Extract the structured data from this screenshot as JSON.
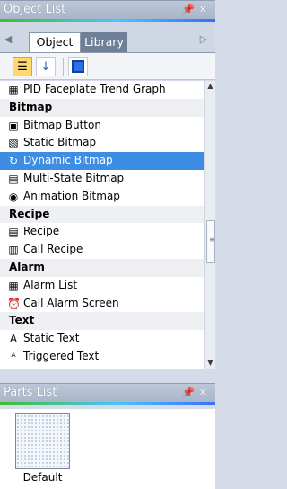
{
  "object_panel": {
    "title": "Object List",
    "title_icons": "† ×",
    "tabs": [
      {
        "label": "Object",
        "active": true
      },
      {
        "label": "Library",
        "active": false
      }
    ],
    "toolbar": {
      "categorized_icon": "categorized-view-icon",
      "sort_icon": "sort-az-icon",
      "view_icon": "large-icon-view-icon"
    },
    "rows": [
      {
        "type": "item",
        "label": "PID Faceplate Trend Graph",
        "icon": "pid-faceplate-icon",
        "glyph": "▦"
      },
      {
        "type": "cat",
        "label": "Bitmap"
      },
      {
        "type": "item",
        "label": "Bitmap Button",
        "icon": "bitmap-button-icon",
        "glyph": "▣"
      },
      {
        "type": "item",
        "label": "Static Bitmap",
        "icon": "static-bitmap-icon",
        "glyph": "▧"
      },
      {
        "type": "item",
        "label": "Dynamic Bitmap",
        "icon": "dynamic-bitmap-icon",
        "glyph": "↻",
        "selected": true
      },
      {
        "type": "item",
        "label": "Multi-State Bitmap",
        "icon": "multi-state-bitmap-icon",
        "glyph": "▤"
      },
      {
        "type": "item",
        "label": "Animation Bitmap",
        "icon": "animation-bitmap-icon",
        "glyph": "◉"
      },
      {
        "type": "cat",
        "label": "Recipe"
      },
      {
        "type": "item",
        "label": "Recipe",
        "icon": "recipe-icon",
        "glyph": "▤"
      },
      {
        "type": "item",
        "label": "Call Recipe",
        "icon": "call-recipe-icon",
        "glyph": "▥"
      },
      {
        "type": "cat",
        "label": "Alarm"
      },
      {
        "type": "item",
        "label": "Alarm List",
        "icon": "alarm-list-icon",
        "glyph": "▦"
      },
      {
        "type": "item",
        "label": "Call Alarm Screen",
        "icon": "alarm-clock-icon",
        "glyph": "⏰"
      },
      {
        "type": "cat",
        "label": "Text"
      },
      {
        "type": "item",
        "label": "Static Text",
        "icon": "static-text-icon",
        "glyph": "A"
      },
      {
        "type": "item",
        "label": "Triggered Text",
        "icon": "triggered-text-icon",
        "glyph": "ᴬ"
      }
    ]
  },
  "parts_panel": {
    "title": "Parts List",
    "title_icons": "† ×",
    "items": [
      {
        "label": "Default"
      }
    ]
  },
  "colors": {
    "selection": "#3d8ee2",
    "title_bar": "#a9b5c9",
    "active_tab": "#ffffff",
    "inactive_tab": "#6f7f98"
  }
}
